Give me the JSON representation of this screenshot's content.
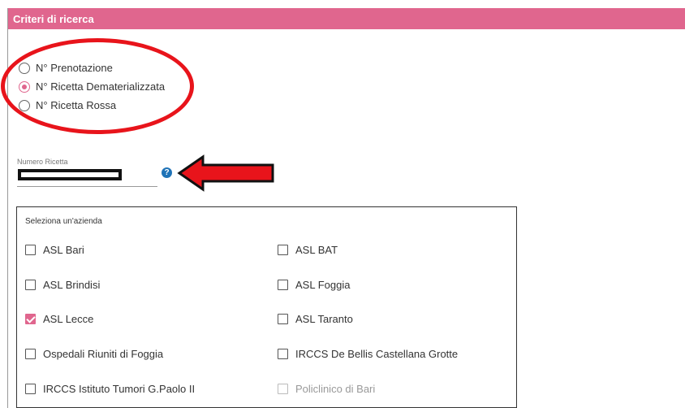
{
  "header": {
    "title": "Criteri di ricerca"
  },
  "search_type": {
    "options": [
      {
        "label": "N° Prenotazione",
        "selected": false
      },
      {
        "label": "N° Ricetta Dematerializzata",
        "selected": true
      },
      {
        "label": "N° Ricetta Rossa",
        "selected": false
      }
    ]
  },
  "recipe_field": {
    "label": "Numero Ricetta",
    "help_icon": "?"
  },
  "companies": {
    "title": "Seleziona un'azienda",
    "items": [
      {
        "label": "ASL Bari",
        "checked": false,
        "disabled": false
      },
      {
        "label": "ASL BAT",
        "checked": false,
        "disabled": false
      },
      {
        "label": "ASL Brindisi",
        "checked": false,
        "disabled": false
      },
      {
        "label": "ASL Foggia",
        "checked": false,
        "disabled": false
      },
      {
        "label": "ASL Lecce",
        "checked": true,
        "disabled": false
      },
      {
        "label": "ASL Taranto",
        "checked": false,
        "disabled": false
      },
      {
        "label": "Ospedali Riuniti di Foggia",
        "checked": false,
        "disabled": false
      },
      {
        "label": "IRCCS De Bellis Castellana Grotte",
        "checked": false,
        "disabled": false
      },
      {
        "label": "IRCCS Istituto Tumori G.Paolo II",
        "checked": false,
        "disabled": false
      },
      {
        "label": "Policlinico di Bari",
        "checked": false,
        "disabled": true
      }
    ]
  },
  "colors": {
    "accent": "#e0668e",
    "annotation": "#e8141b",
    "help": "#1f73b7"
  }
}
